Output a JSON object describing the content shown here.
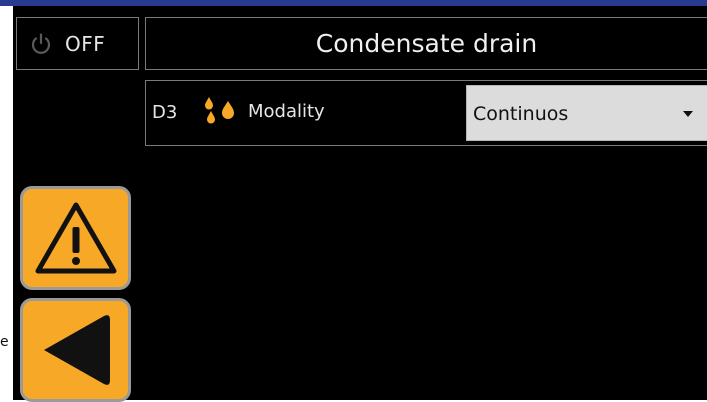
{
  "power": {
    "label": "OFF",
    "icon": "power-icon"
  },
  "header": {
    "title": "Condensate drain"
  },
  "setting": {
    "code": "D3",
    "icon": "water-drops-icon",
    "label": "Modality",
    "value": "Continuos"
  },
  "side_buttons": {
    "warning_icon": "warning-icon",
    "back_icon": "back-arrow-icon"
  },
  "edge_text": "e",
  "colors": {
    "accent": "#f7a827",
    "background": "#000000",
    "text": "#e6e6e6",
    "select_bg": "#dcdcdc",
    "topbar": "#2a3b8f"
  }
}
